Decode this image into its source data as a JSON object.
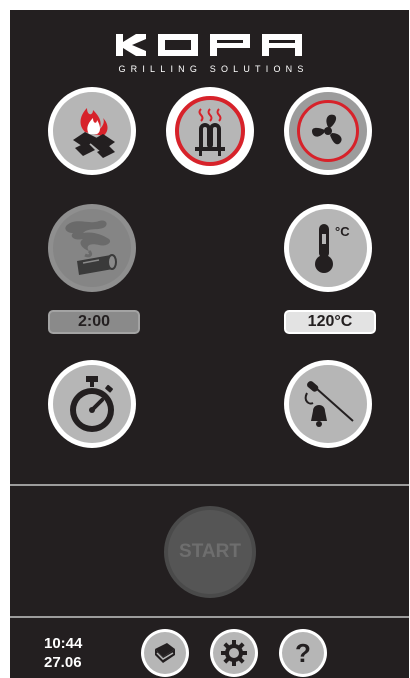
{
  "brand": {
    "logo_text": "KOPA",
    "tagline": "GRILLING SOLUTIONS"
  },
  "modes": [
    {
      "name": "charcoal-fire",
      "icon": "fire-coal-icon",
      "active": false
    },
    {
      "name": "heating-element",
      "icon": "heating-element-icon",
      "active": true
    },
    {
      "name": "fan",
      "icon": "fan-icon",
      "active": true
    }
  ],
  "smoke": {
    "icon": "smoke-log-icon",
    "time_value": "2:00",
    "enabled": false
  },
  "temperature": {
    "icon": "thermometer-icon",
    "unit_symbol": "°C",
    "value": "120°C"
  },
  "timer": {
    "icon": "stopwatch-icon"
  },
  "probe_alarm": {
    "icon": "probe-bell-icon"
  },
  "start": {
    "label": "START",
    "enabled": false
  },
  "status": {
    "time": "10:44",
    "date": "27.06"
  },
  "bottom_bar": [
    {
      "name": "manual",
      "icon": "book-icon"
    },
    {
      "name": "settings",
      "icon": "gear-icon"
    },
    {
      "name": "help",
      "icon": "help-icon",
      "label": "?"
    }
  ],
  "colors": {
    "background": "#231f20",
    "accent_red": "#d7222a",
    "button_gray": "#b6b6b6",
    "disabled_gray": "#858585"
  }
}
